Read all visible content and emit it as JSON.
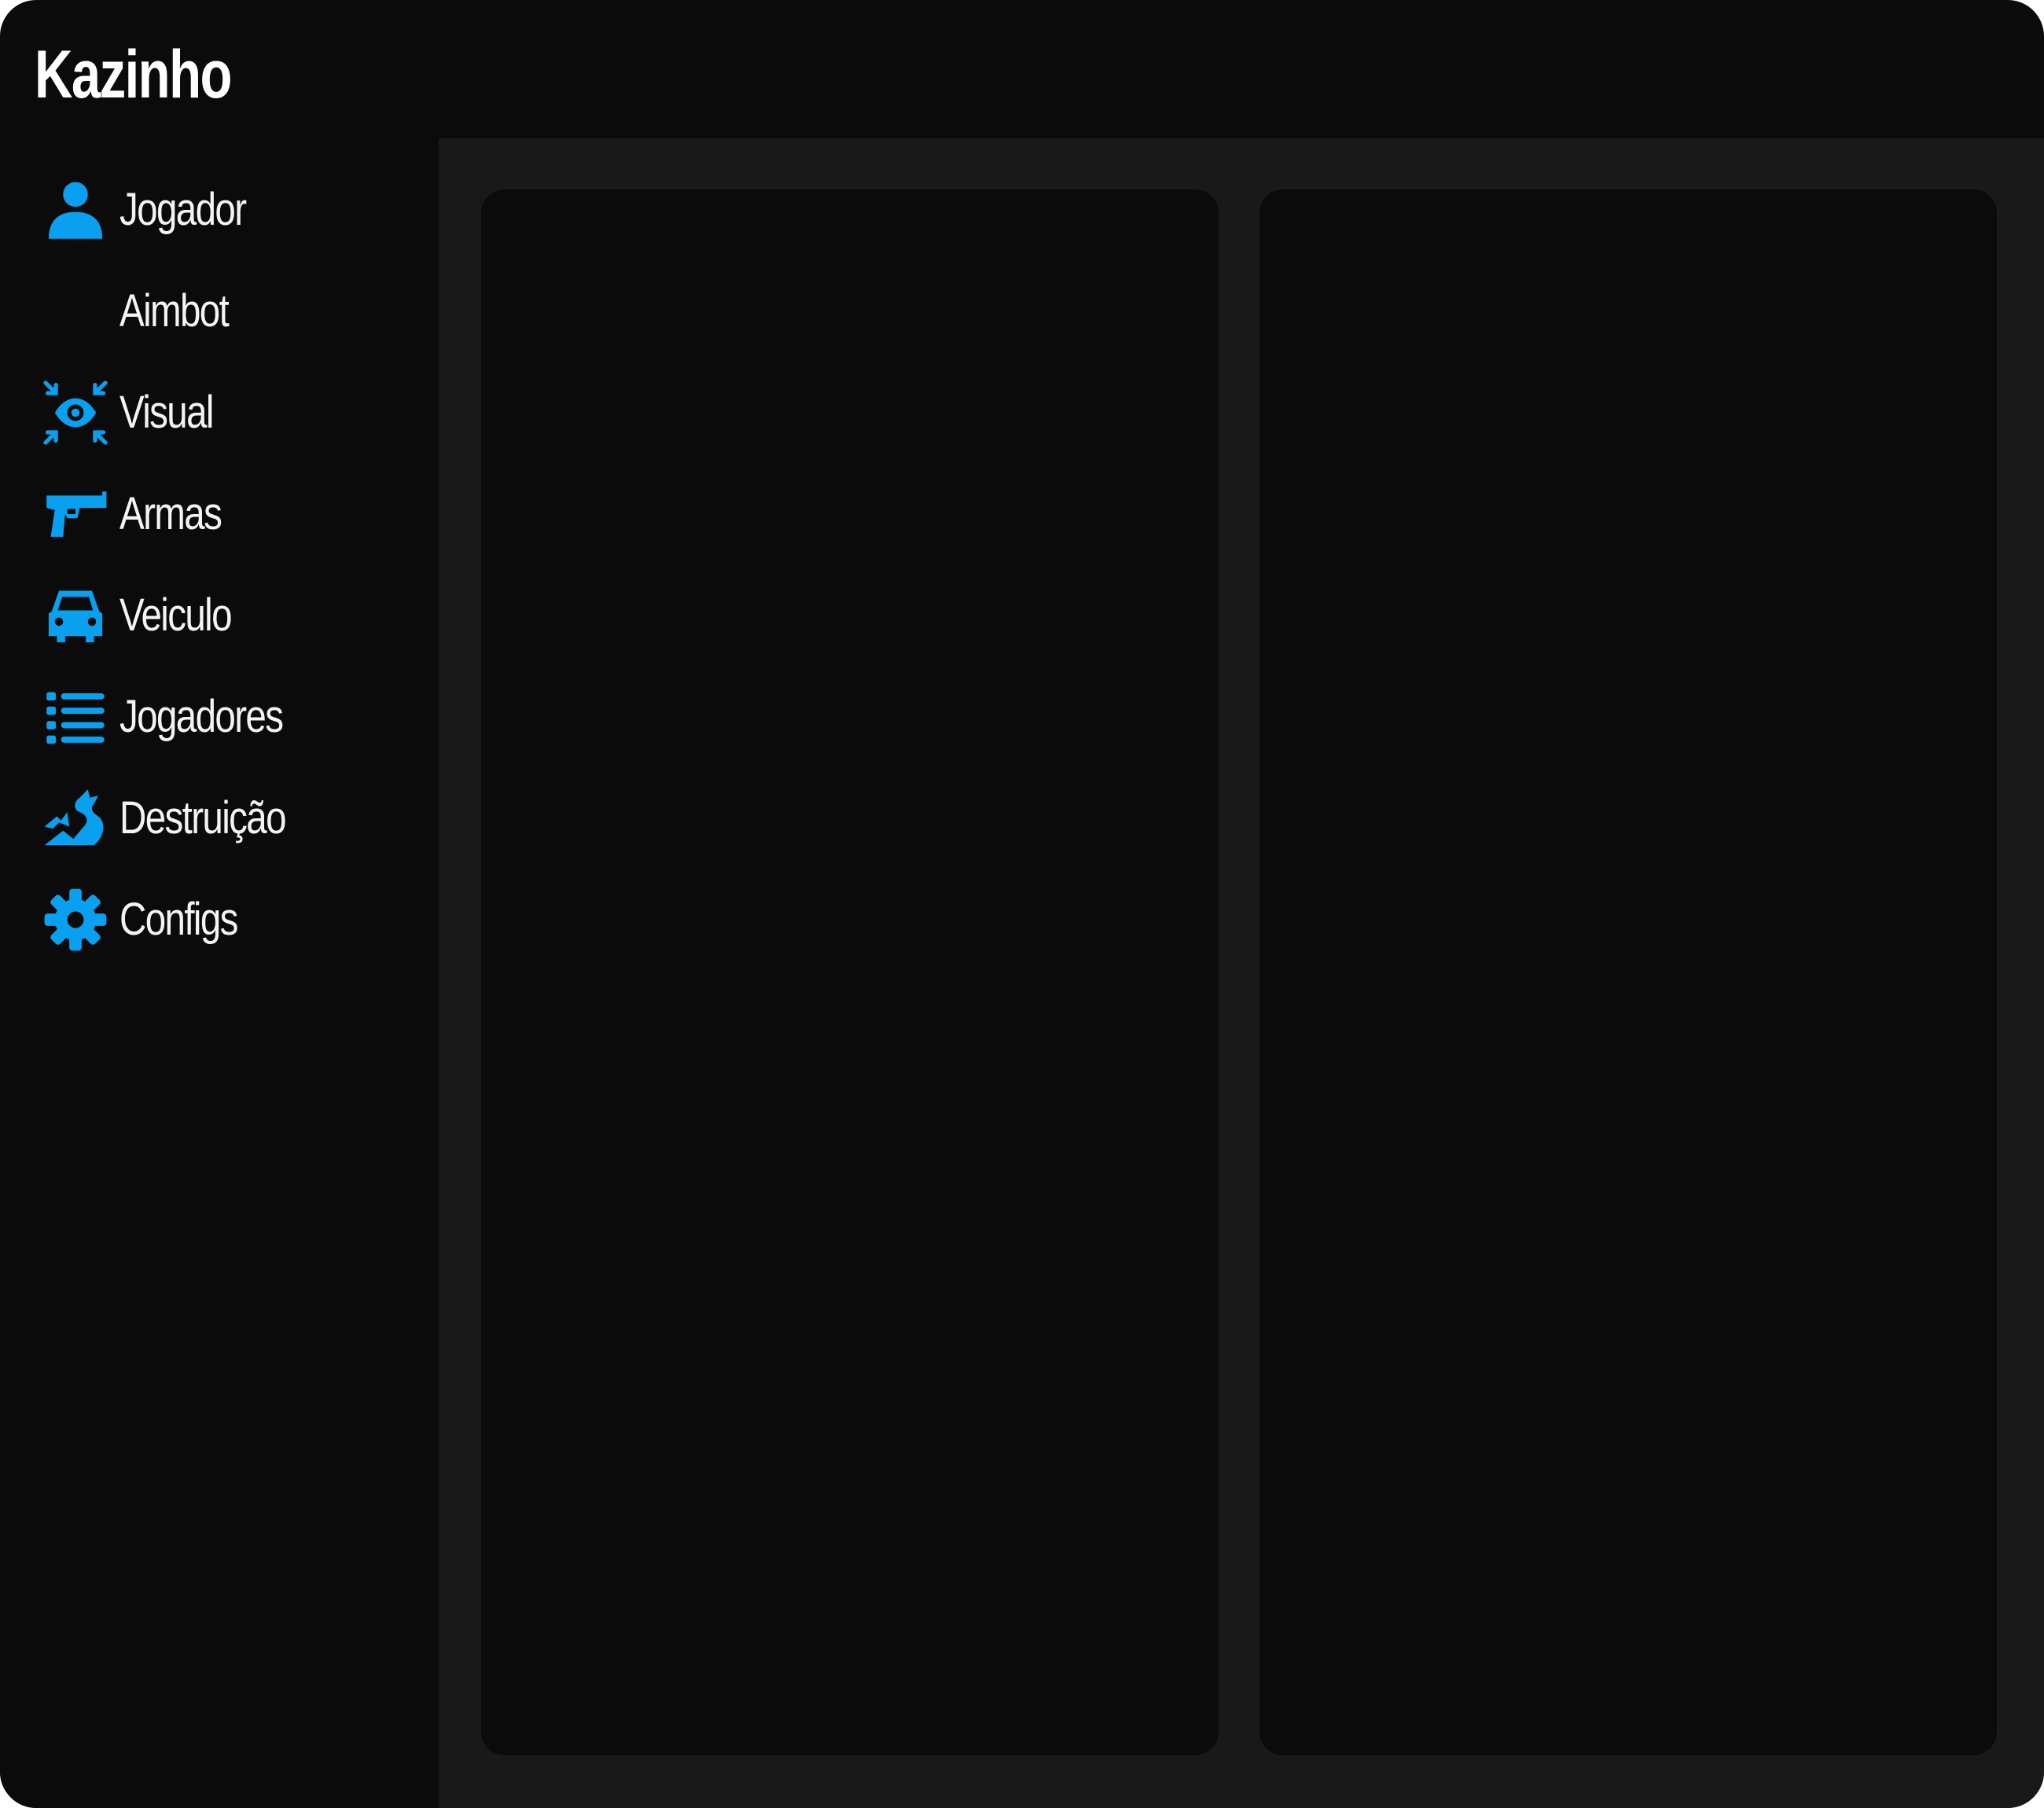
{
  "app": {
    "title": "Kazinho"
  },
  "sidebar": {
    "items": [
      {
        "label": "Jogador",
        "icon": "user-icon"
      },
      {
        "label": "Aimbot",
        "icon": "crescent-moon-icon"
      },
      {
        "label": "Visual",
        "icon": "eye-focus-icon"
      },
      {
        "label": "Armas",
        "icon": "pistol-icon"
      },
      {
        "label": "Veiculo",
        "icon": "car-icon"
      },
      {
        "label": "Jogadores",
        "icon": "list-icon"
      },
      {
        "label": "Destruição",
        "icon": "destruction-icon"
      },
      {
        "label": "Configs",
        "icon": "gear-icon"
      }
    ]
  },
  "colors": {
    "accent": "#0aa0f0",
    "window_bg": "#0b0b0b",
    "content_bg": "#191919",
    "panel_bg": "#0b0b0b",
    "text": "#f4f4f4"
  }
}
